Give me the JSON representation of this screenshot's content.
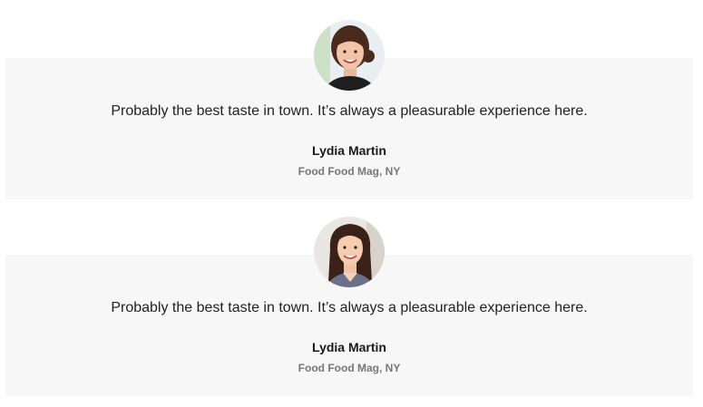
{
  "testimonials": [
    {
      "quote": "Probably the best taste in town. It’s always a pleasurable experience here.",
      "author": "Lydia Martin",
      "organization": "Food Food Mag, NY",
      "avatar_icon": "person-portrait-dark-hair"
    },
    {
      "quote": "Probably the best taste in town. It’s always a pleasurable experience here.",
      "author": "Lydia Martin",
      "organization": "Food Food Mag, NY",
      "avatar_icon": "person-portrait-long-hair"
    }
  ],
  "colors": {
    "card_background": "#f7f7f7",
    "quote_text": "#222222",
    "author_text": "#1a1a1a",
    "org_text": "#777777"
  }
}
